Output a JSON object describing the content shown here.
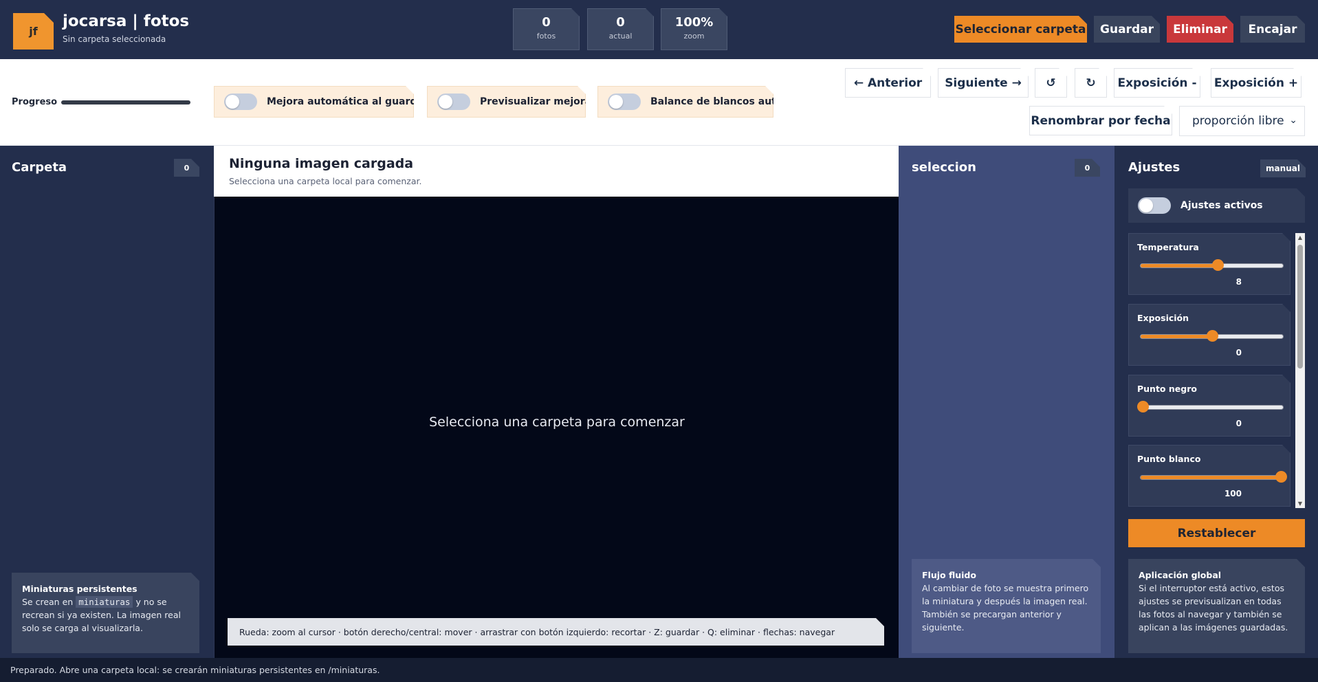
{
  "header": {
    "logo_text": "jf",
    "app_title": "jocarsa | fotos",
    "subtitle": "Sin carpeta seleccionada",
    "stats": [
      {
        "value": "0",
        "label": "fotos"
      },
      {
        "value": "0",
        "label": "actual"
      },
      {
        "value": "100%",
        "label": "zoom"
      }
    ],
    "buttons": {
      "select_folder": "Seleccionar carpeta",
      "save": "Guardar",
      "delete": "Eliminar",
      "fit": "Encajar"
    }
  },
  "toolbar": {
    "progress_label": "Progreso",
    "progress_value": 1.0,
    "toggles": [
      {
        "label": "Mejora automática al guardar",
        "on": false
      },
      {
        "label": "Previsualizar mejora",
        "on": false
      },
      {
        "label": "Balance de blancos auto",
        "on": false
      }
    ],
    "buttons": {
      "prev": "← Anterior",
      "next": "Siguiente →",
      "rotate_left": "↺",
      "rotate_right": "↻",
      "exposure_minus": "Exposición -",
      "exposure_plus": "Exposición +",
      "rename_by_date": "Renombrar por fecha"
    },
    "ratio_select": "proporción libre"
  },
  "left_panel": {
    "title": "Carpeta",
    "count": "0",
    "info_title": "Miniaturas persistentes",
    "info_pre": "Se crean en",
    "info_code": "miniaturas",
    "info_post": "y no se recrean si ya existen. La imagen real solo se carga al visualizarla."
  },
  "center": {
    "title": "Ninguna imagen cargada",
    "subtitle": "Selecciona una carpeta local para comenzar.",
    "viewer_message": "Selecciona una carpeta para comenzar",
    "hint": "Rueda: zoom al cursor · botón derecho/central: mover · arrastrar con botón izquierdo: recortar · Z: guardar · Q: eliminar · flechas: navegar"
  },
  "selection_panel": {
    "title": "seleccion",
    "count": "0",
    "info_title": "Flujo fluido",
    "info_text": "Al cambiar de foto se muestra primero la miniatura y después la imagen real. También se precargan anterior y siguiente."
  },
  "adjust_panel": {
    "title": "Ajustes",
    "mode": "manual",
    "active_label": "Ajustes activos",
    "active_on": false,
    "sliders": [
      {
        "label": "Temperatura",
        "value": "8",
        "min": -100,
        "max": 100,
        "num": 8
      },
      {
        "label": "Exposición",
        "value": "0",
        "min": -100,
        "max": 100,
        "num": 0
      },
      {
        "label": "Punto negro",
        "value": "0",
        "min": 0,
        "max": 100,
        "num": 0
      },
      {
        "label": "Punto blanco",
        "value": "100",
        "min": 0,
        "max": 100,
        "num": 100
      }
    ],
    "reset": "Restablecer",
    "info_title": "Aplicación global",
    "info_text": "Si el interruptor está activo, estos ajustes se previsualizan en todas las fotos al navegar y también se aplican a las imágenes guardadas."
  },
  "status_bar": "Preparado. Abre una carpeta local: se crearán miniaturas persistentes en /miniaturas.",
  "colors": {
    "accent": "#ed8a26",
    "danger": "#c9383b",
    "background": "#232e4c",
    "selection_panel": "#3f4c7a"
  }
}
